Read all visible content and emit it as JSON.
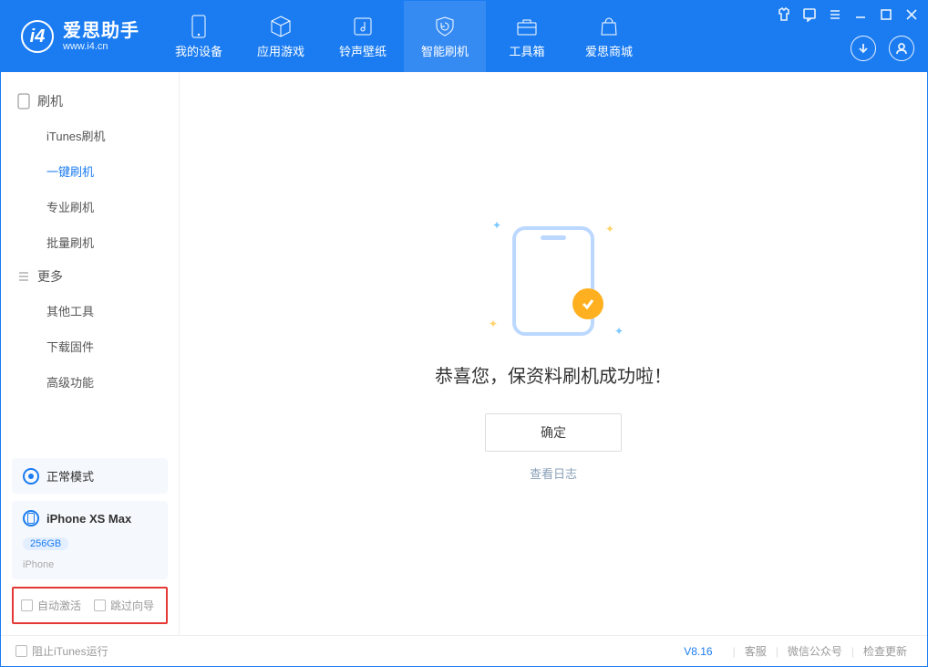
{
  "app": {
    "title": "爱思助手",
    "subtitle": "www.i4.cn"
  },
  "header_tabs": [
    {
      "label": "我的设备"
    },
    {
      "label": "应用游戏"
    },
    {
      "label": "铃声壁纸"
    },
    {
      "label": "智能刷机"
    },
    {
      "label": "工具箱"
    },
    {
      "label": "爱思商城"
    }
  ],
  "sidebar": {
    "group1_title": "刷机",
    "items1": [
      {
        "label": "iTunes刷机"
      },
      {
        "label": "一键刷机"
      },
      {
        "label": "专业刷机"
      },
      {
        "label": "批量刷机"
      }
    ],
    "group2_title": "更多",
    "items2": [
      {
        "label": "其他工具"
      },
      {
        "label": "下载固件"
      },
      {
        "label": "高级功能"
      }
    ]
  },
  "mode": {
    "label": "正常模式"
  },
  "device": {
    "name": "iPhone XS Max",
    "capacity": "256GB",
    "type": "iPhone"
  },
  "options": {
    "auto_activate": "自动激活",
    "skip_guide": "跳过向导"
  },
  "main": {
    "success_title": "恭喜您，保资料刷机成功啦！",
    "confirm": "确定",
    "view_log": "查看日志"
  },
  "footer": {
    "block_itunes": "阻止iTunes运行",
    "version": "V8.16",
    "links": [
      "客服",
      "微信公众号",
      "检查更新"
    ]
  }
}
